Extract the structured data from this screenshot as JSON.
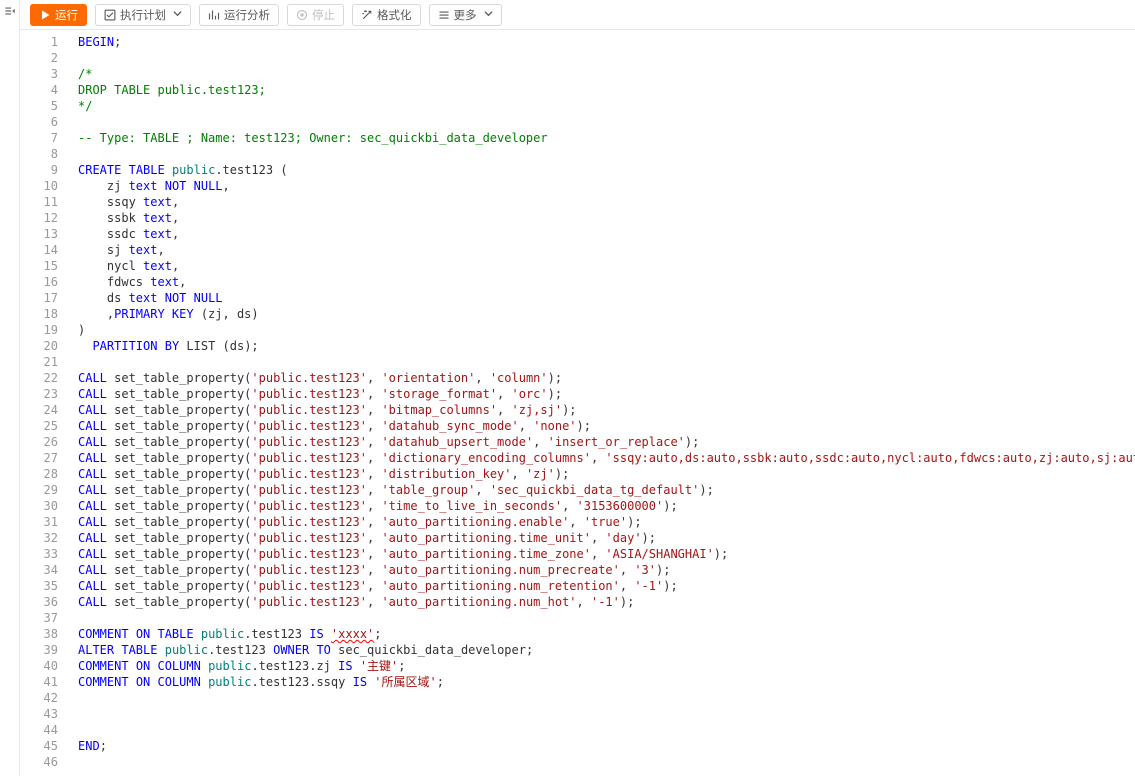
{
  "toolbar": {
    "run": "运行",
    "exec_plan": "执行计划",
    "run_analysis": "运行分析",
    "stop": "停止",
    "format": "格式化",
    "more": "更多"
  },
  "icons": {
    "collapse": "collapse-icon",
    "play": "play-icon",
    "check": "check-icon",
    "analyze": "analyze-icon",
    "stop": "stop-icon",
    "magic": "magic-icon",
    "menu": "menu-icon",
    "chevron_down": "chevron-down-icon"
  },
  "code": {
    "lines": 46,
    "l1": [
      {
        "c": "kw",
        "t": "BEGIN"
      },
      {
        "c": "sym",
        "t": ";"
      }
    ],
    "l2": [],
    "l3": [
      {
        "c": "cm",
        "t": "/*"
      }
    ],
    "l4": [
      {
        "c": "cm",
        "t": "DROP TABLE public.test123;"
      }
    ],
    "l5": [
      {
        "c": "cm",
        "t": "*/"
      }
    ],
    "l6": [],
    "l7": [
      {
        "c": "cm",
        "t": "-- Type: TABLE ; Name: test123; Owner: sec_quickbi_data_developer"
      }
    ],
    "l8": [],
    "l9": [
      {
        "c": "kw",
        "t": "CREATE"
      },
      {
        "c": "sym",
        "t": " "
      },
      {
        "c": "kw",
        "t": "TABLE"
      },
      {
        "c": "sym",
        "t": " "
      },
      {
        "c": "ty",
        "t": "public"
      },
      {
        "c": "sym",
        "t": ".test123 ("
      }
    ],
    "l10": [
      {
        "c": "sym",
        "t": "    zj "
      },
      {
        "c": "kw",
        "t": "text"
      },
      {
        "c": "sym",
        "t": " "
      },
      {
        "c": "kw",
        "t": "NOT NULL"
      },
      {
        "c": "sym",
        "t": ","
      }
    ],
    "l11": [
      {
        "c": "sym",
        "t": "    ssqy "
      },
      {
        "c": "kw",
        "t": "text"
      },
      {
        "c": "sym",
        "t": ","
      }
    ],
    "l12": [
      {
        "c": "sym",
        "t": "    ssbk "
      },
      {
        "c": "kw",
        "t": "text"
      },
      {
        "c": "sym",
        "t": ","
      }
    ],
    "l13": [
      {
        "c": "sym",
        "t": "    ssdc "
      },
      {
        "c": "kw",
        "t": "text"
      },
      {
        "c": "sym",
        "t": ","
      }
    ],
    "l14": [
      {
        "c": "sym",
        "t": "    sj "
      },
      {
        "c": "kw",
        "t": "text"
      },
      {
        "c": "sym",
        "t": ","
      }
    ],
    "l15": [
      {
        "c": "sym",
        "t": "    nycl "
      },
      {
        "c": "kw",
        "t": "text"
      },
      {
        "c": "sym",
        "t": ","
      }
    ],
    "l16": [
      {
        "c": "sym",
        "t": "    fdwcs "
      },
      {
        "c": "kw",
        "t": "text"
      },
      {
        "c": "sym",
        "t": ","
      }
    ],
    "l17": [
      {
        "c": "sym",
        "t": "    ds "
      },
      {
        "c": "kw",
        "t": "text"
      },
      {
        "c": "sym",
        "t": " "
      },
      {
        "c": "kw",
        "t": "NOT NULL"
      }
    ],
    "l18": [
      {
        "c": "sym",
        "t": "    ,"
      },
      {
        "c": "kw",
        "t": "PRIMARY KEY"
      },
      {
        "c": "sym",
        "t": " (zj, ds)"
      }
    ],
    "l19": [
      {
        "c": "sym",
        "t": ")"
      }
    ],
    "l20": [
      {
        "c": "sym",
        "t": "  "
      },
      {
        "c": "kw",
        "t": "PARTITION"
      },
      {
        "c": "sym",
        "t": " "
      },
      {
        "c": "kw",
        "t": "BY"
      },
      {
        "c": "sym",
        "t": " LIST (ds);"
      }
    ],
    "l21": [],
    "l22": [
      {
        "c": "kw",
        "t": "CALL"
      },
      {
        "c": "sym",
        "t": " set_table_property("
      },
      {
        "c": "st",
        "t": "'public.test123'"
      },
      {
        "c": "sym",
        "t": ", "
      },
      {
        "c": "st",
        "t": "'orientation'"
      },
      {
        "c": "sym",
        "t": ", "
      },
      {
        "c": "st",
        "t": "'column'"
      },
      {
        "c": "sym",
        "t": ");"
      }
    ],
    "l23": [
      {
        "c": "kw",
        "t": "CALL"
      },
      {
        "c": "sym",
        "t": " set_table_property("
      },
      {
        "c": "st",
        "t": "'public.test123'"
      },
      {
        "c": "sym",
        "t": ", "
      },
      {
        "c": "st",
        "t": "'storage_format'"
      },
      {
        "c": "sym",
        "t": ", "
      },
      {
        "c": "st",
        "t": "'orc'"
      },
      {
        "c": "sym",
        "t": ");"
      }
    ],
    "l24": [
      {
        "c": "kw",
        "t": "CALL"
      },
      {
        "c": "sym",
        "t": " set_table_property("
      },
      {
        "c": "st",
        "t": "'public.test123'"
      },
      {
        "c": "sym",
        "t": ", "
      },
      {
        "c": "st",
        "t": "'bitmap_columns'"
      },
      {
        "c": "sym",
        "t": ", "
      },
      {
        "c": "st",
        "t": "'zj,sj'"
      },
      {
        "c": "sym",
        "t": ");"
      }
    ],
    "l25": [
      {
        "c": "kw",
        "t": "CALL"
      },
      {
        "c": "sym",
        "t": " set_table_property("
      },
      {
        "c": "st",
        "t": "'public.test123'"
      },
      {
        "c": "sym",
        "t": ", "
      },
      {
        "c": "st",
        "t": "'datahub_sync_mode'"
      },
      {
        "c": "sym",
        "t": ", "
      },
      {
        "c": "st",
        "t": "'none'"
      },
      {
        "c": "sym",
        "t": ");"
      }
    ],
    "l26": [
      {
        "c": "kw",
        "t": "CALL"
      },
      {
        "c": "sym",
        "t": " set_table_property("
      },
      {
        "c": "st",
        "t": "'public.test123'"
      },
      {
        "c": "sym",
        "t": ", "
      },
      {
        "c": "st",
        "t": "'datahub_upsert_mode'"
      },
      {
        "c": "sym",
        "t": ", "
      },
      {
        "c": "st",
        "t": "'insert_or_replace'"
      },
      {
        "c": "sym",
        "t": ");"
      }
    ],
    "l27": [
      {
        "c": "kw",
        "t": "CALL"
      },
      {
        "c": "sym",
        "t": " set_table_property("
      },
      {
        "c": "st",
        "t": "'public.test123'"
      },
      {
        "c": "sym",
        "t": ", "
      },
      {
        "c": "st",
        "t": "'dictionary_encoding_columns'"
      },
      {
        "c": "sym",
        "t": ", "
      },
      {
        "c": "st",
        "t": "'ssqy:auto,ds:auto,ssbk:auto,ssdc:auto,nycl:auto,fdwcs:auto,zj:auto,sj:auto'"
      },
      {
        "c": "sym",
        "t": ");"
      }
    ],
    "l28": [
      {
        "c": "kw",
        "t": "CALL"
      },
      {
        "c": "sym",
        "t": " set_table_property("
      },
      {
        "c": "st",
        "t": "'public.test123'"
      },
      {
        "c": "sym",
        "t": ", "
      },
      {
        "c": "st",
        "t": "'distribution_key'"
      },
      {
        "c": "sym",
        "t": ", "
      },
      {
        "c": "st",
        "t": "'zj'"
      },
      {
        "c": "sym",
        "t": ");"
      }
    ],
    "l29": [
      {
        "c": "kw",
        "t": "CALL"
      },
      {
        "c": "sym",
        "t": " set_table_property("
      },
      {
        "c": "st",
        "t": "'public.test123'"
      },
      {
        "c": "sym",
        "t": ", "
      },
      {
        "c": "st",
        "t": "'table_group'"
      },
      {
        "c": "sym",
        "t": ", "
      },
      {
        "c": "st",
        "t": "'sec_quickbi_data_tg_default'"
      },
      {
        "c": "sym",
        "t": ");"
      }
    ],
    "l30": [
      {
        "c": "kw",
        "t": "CALL"
      },
      {
        "c": "sym",
        "t": " set_table_property("
      },
      {
        "c": "st",
        "t": "'public.test123'"
      },
      {
        "c": "sym",
        "t": ", "
      },
      {
        "c": "st",
        "t": "'time_to_live_in_seconds'"
      },
      {
        "c": "sym",
        "t": ", "
      },
      {
        "c": "st",
        "t": "'3153600000'"
      },
      {
        "c": "sym",
        "t": ");"
      }
    ],
    "l31": [
      {
        "c": "kw",
        "t": "CALL"
      },
      {
        "c": "sym",
        "t": " set_table_property("
      },
      {
        "c": "st",
        "t": "'public.test123'"
      },
      {
        "c": "sym",
        "t": ", "
      },
      {
        "c": "st",
        "t": "'auto_partitioning.enable'"
      },
      {
        "c": "sym",
        "t": ", "
      },
      {
        "c": "st",
        "t": "'true'"
      },
      {
        "c": "sym",
        "t": ");"
      }
    ],
    "l32": [
      {
        "c": "kw",
        "t": "CALL"
      },
      {
        "c": "sym",
        "t": " set_table_property("
      },
      {
        "c": "st",
        "t": "'public.test123'"
      },
      {
        "c": "sym",
        "t": ", "
      },
      {
        "c": "st",
        "t": "'auto_partitioning.time_unit'"
      },
      {
        "c": "sym",
        "t": ", "
      },
      {
        "c": "st",
        "t": "'day'"
      },
      {
        "c": "sym",
        "t": ");"
      }
    ],
    "l33": [
      {
        "c": "kw",
        "t": "CALL"
      },
      {
        "c": "sym",
        "t": " set_table_property("
      },
      {
        "c": "st",
        "t": "'public.test123'"
      },
      {
        "c": "sym",
        "t": ", "
      },
      {
        "c": "st",
        "t": "'auto_partitioning.time_zone'"
      },
      {
        "c": "sym",
        "t": ", "
      },
      {
        "c": "st",
        "t": "'ASIA/SHANGHAI'"
      },
      {
        "c": "sym",
        "t": ");"
      }
    ],
    "l34": [
      {
        "c": "kw",
        "t": "CALL"
      },
      {
        "c": "sym",
        "t": " set_table_property("
      },
      {
        "c": "st",
        "t": "'public.test123'"
      },
      {
        "c": "sym",
        "t": ", "
      },
      {
        "c": "st",
        "t": "'auto_partitioning.num_precreate'"
      },
      {
        "c": "sym",
        "t": ", "
      },
      {
        "c": "st",
        "t": "'3'"
      },
      {
        "c": "sym",
        "t": ");"
      }
    ],
    "l35": [
      {
        "c": "kw",
        "t": "CALL"
      },
      {
        "c": "sym",
        "t": " set_table_property("
      },
      {
        "c": "st",
        "t": "'public.test123'"
      },
      {
        "c": "sym",
        "t": ", "
      },
      {
        "c": "st",
        "t": "'auto_partitioning.num_retention'"
      },
      {
        "c": "sym",
        "t": ", "
      },
      {
        "c": "st",
        "t": "'-1'"
      },
      {
        "c": "sym",
        "t": ");"
      }
    ],
    "l36": [
      {
        "c": "kw",
        "t": "CALL"
      },
      {
        "c": "sym",
        "t": " set_table_property("
      },
      {
        "c": "st",
        "t": "'public.test123'"
      },
      {
        "c": "sym",
        "t": ", "
      },
      {
        "c": "st",
        "t": "'auto_partitioning.num_hot'"
      },
      {
        "c": "sym",
        "t": ", "
      },
      {
        "c": "st",
        "t": "'-1'"
      },
      {
        "c": "sym",
        "t": ");"
      }
    ],
    "l37": [],
    "l38": [
      {
        "c": "kw",
        "t": "COMMENT"
      },
      {
        "c": "sym",
        "t": " "
      },
      {
        "c": "kw",
        "t": "ON TABLE"
      },
      {
        "c": "sym",
        "t": " "
      },
      {
        "c": "ty",
        "t": "public"
      },
      {
        "c": "sym",
        "t": ".test123 "
      },
      {
        "c": "kw",
        "t": "IS"
      },
      {
        "c": "sym",
        "t": " "
      },
      {
        "c": "st squiggly",
        "t": "'xxxx'"
      },
      {
        "c": "sym",
        "t": ";"
      }
    ],
    "l39": [
      {
        "c": "kw",
        "t": "ALTER"
      },
      {
        "c": "sym",
        "t": " "
      },
      {
        "c": "kw",
        "t": "TABLE"
      },
      {
        "c": "sym",
        "t": " "
      },
      {
        "c": "ty",
        "t": "public"
      },
      {
        "c": "sym",
        "t": ".test123 "
      },
      {
        "c": "kw",
        "t": "OWNER TO"
      },
      {
        "c": "sym",
        "t": " sec_quickbi_data_developer;"
      }
    ],
    "l40": [
      {
        "c": "kw",
        "t": "COMMENT"
      },
      {
        "c": "sym",
        "t": " "
      },
      {
        "c": "kw",
        "t": "ON COLUMN"
      },
      {
        "c": "sym",
        "t": " "
      },
      {
        "c": "ty",
        "t": "public"
      },
      {
        "c": "sym",
        "t": ".test123.zj "
      },
      {
        "c": "kw",
        "t": "IS"
      },
      {
        "c": "sym",
        "t": " "
      },
      {
        "c": "st",
        "t": "'主键'"
      },
      {
        "c": "sym",
        "t": ";"
      }
    ],
    "l41": [
      {
        "c": "kw",
        "t": "COMMENT"
      },
      {
        "c": "sym",
        "t": " "
      },
      {
        "c": "kw",
        "t": "ON COLUMN"
      },
      {
        "c": "sym",
        "t": " "
      },
      {
        "c": "ty",
        "t": "public"
      },
      {
        "c": "sym",
        "t": ".test123.ssqy "
      },
      {
        "c": "kw",
        "t": "IS"
      },
      {
        "c": "sym",
        "t": " "
      },
      {
        "c": "st",
        "t": "'所属区域'"
      },
      {
        "c": "sym",
        "t": ";"
      }
    ],
    "l42": [],
    "l43": [],
    "l44": [],
    "l45": [
      {
        "c": "kw",
        "t": "END"
      },
      {
        "c": "sym",
        "t": ";"
      }
    ],
    "l46": []
  }
}
